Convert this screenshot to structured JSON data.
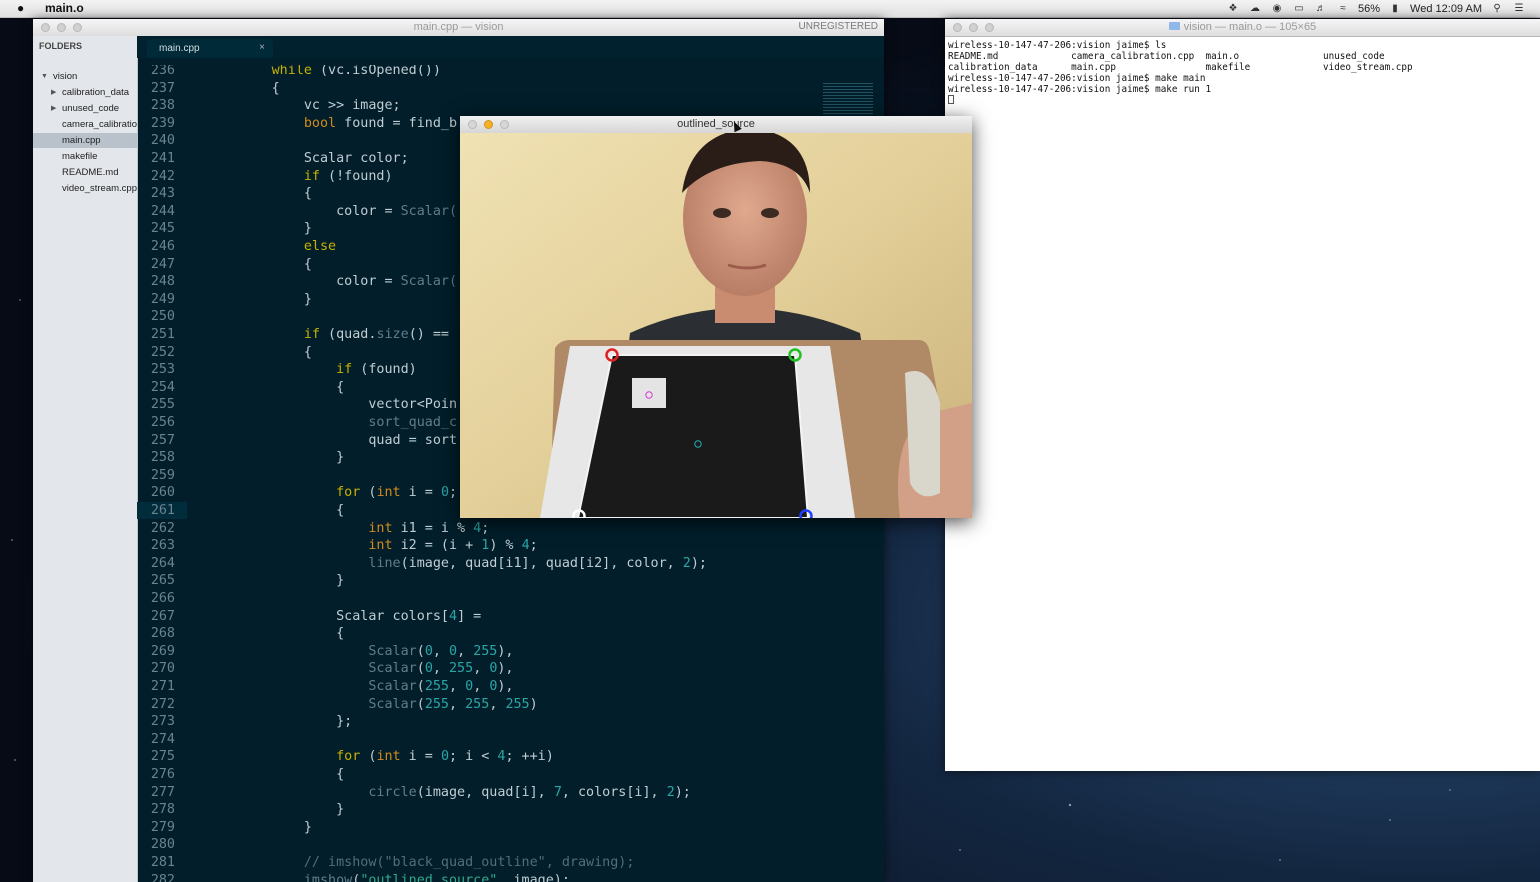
{
  "menubar": {
    "app_name": "main.o",
    "battery": "56%",
    "clock": "Wed 12:09 AM",
    "icons": [
      "apple-icon",
      "dropbox-icon",
      "cloud-icon",
      "record-icon",
      "airplay-icon",
      "volume-icon",
      "wifi-icon",
      "battery-icon",
      "spotlight-icon",
      "notification-icon"
    ]
  },
  "editor": {
    "title": "main.cpp — vision",
    "unregistered": "UNREGISTERED",
    "tab_label": "main.cpp",
    "tab_close": "×",
    "sidebar": {
      "header": "FOLDERS",
      "items": [
        {
          "label": "vision"
        },
        {
          "label": "calibration_data"
        },
        {
          "label": "unused_code"
        },
        {
          "label": "camera_calibration.cpp"
        },
        {
          "label": "main.cpp"
        },
        {
          "label": "makefile"
        },
        {
          "label": "README.md"
        },
        {
          "label": "video_stream.cpp"
        }
      ]
    },
    "line_numbers": [
      "236",
      "237",
      "238",
      "239",
      "240",
      "241",
      "242",
      "243",
      "244",
      "245",
      "246",
      "247",
      "248",
      "249",
      "250",
      "251",
      "252",
      "253",
      "254",
      "255",
      "256",
      "257",
      "258",
      "259",
      "260",
      "261",
      "262",
      "263",
      "264",
      "265",
      "266",
      "267",
      "268",
      "269",
      "270",
      "271",
      "272",
      "273",
      "274",
      "275",
      "276",
      "277",
      "278",
      "279",
      "280",
      "281",
      "282"
    ],
    "code": {
      "l236_kw": "while",
      "l236_rest": " (vc.isOpened())",
      "l237": "{",
      "l238": "vc >> image;",
      "l239_kw": "bool",
      "l239_rest": " found = find_b",
      "l241": "Scalar color;",
      "l242_kw": "if",
      "l242_rest": " (!found)",
      "l243": "{",
      "l244_a": "color = ",
      "l244_b": "Scalar(",
      "l245": "}",
      "l246_kw": "else",
      "l247": "{",
      "l248_a": "color = ",
      "l248_b": "Scalar(",
      "l249": "}",
      "l251_kw": "if",
      "l251_a": " (quad.",
      "l251_b": "size",
      "l251_c": "() ==",
      "l252": "{",
      "l253_kw": "if",
      "l253_rest": " (found)",
      "l254": "{",
      "l255": "vector<Poin",
      "l256": "sort_quad_c",
      "l257": "quad = sort",
      "l258": "}",
      "l260_kw": "for",
      "l260_a": " (",
      "l260_t": "int",
      "l260_b": " i = ",
      "l260_n": "0",
      "l260_c": ";",
      "l261": "{",
      "l262_t": "int",
      "l262_a": " i1 = i % ",
      "l262_n": "4",
      "l262_c": ";",
      "l263_t": "int",
      "l263_a": " i2 = (i + ",
      "l263_n1": "1",
      "l263_b": ") % ",
      "l263_n2": "4",
      "l263_c": ";",
      "l264_f": "line",
      "l264_a": "(image, quad[i1], quad[i2], color, ",
      "l264_n": "2",
      "l264_c": ");",
      "l265": "}",
      "l267_a": "Scalar colors[",
      "l267_n": "4",
      "l267_b": "] =",
      "l268": "{",
      "l269_f": "Scalar",
      "l269_a": "(",
      "l269_n1": "0",
      "l269_s1": ", ",
      "l269_n2": "0",
      "l269_s2": ", ",
      "l269_n3": "255",
      "l269_b": "),",
      "l270_f": "Scalar",
      "l270_a": "(",
      "l270_n1": "0",
      "l270_s1": ", ",
      "l270_n2": "255",
      "l270_s2": ", ",
      "l270_n3": "0",
      "l270_b": "),",
      "l271_f": "Scalar",
      "l271_a": "(",
      "l271_n1": "255",
      "l271_s1": ", ",
      "l271_n2": "0",
      "l271_s2": ", ",
      "l271_n3": "0",
      "l271_b": "),",
      "l272_f": "Scalar",
      "l272_a": "(",
      "l272_n1": "255",
      "l272_s1": ", ",
      "l272_n2": "255",
      "l272_s2": ", ",
      "l272_n3": "255",
      "l272_b": ")",
      "l273": "};",
      "l275_kw": "for",
      "l275_a": " (",
      "l275_t": "int",
      "l275_b": " i = ",
      "l275_n1": "0",
      "l275_c": "; i < ",
      "l275_n2": "4",
      "l275_d": "; ++i)",
      "l276": "{",
      "l277_f": "circle",
      "l277_a": "(image, quad[i], ",
      "l277_n1": "7",
      "l277_b": ", colors[i], ",
      "l277_n2": "2",
      "l277_c": ");",
      "l278": "}",
      "l279": "}",
      "l281": "// imshow(\"black_quad_outline\", drawing);",
      "l282_f": "imshow",
      "l282_a": "(",
      "l282_s": "\"outlined_source\"",
      "l282_b": ", image);"
    }
  },
  "terminal": {
    "title": "vision — main.o — 105×65",
    "lines": [
      "wireless-10-147-47-206:vision jaime$ ls",
      "README.md             camera_calibration.cpp  main.o               unused_code",
      "calibration_data      main.cpp                makefile             video_stream.cpp",
      "wireless-10-147-47-206:vision jaime$ make main",
      "wireless-10-147-47-206:vision jaime$ make run 1"
    ]
  },
  "cv_window": {
    "title": "outlined_source"
  },
  "colors": {
    "editor_bg": "#011e2a",
    "keyword": "#c7b000",
    "number": "#2aa6a6",
    "type": "#cf8a1d",
    "corner_red": "#e02020",
    "corner_green": "#20c020",
    "corner_blue": "#2040ff",
    "corner_white": "#ffffff"
  }
}
